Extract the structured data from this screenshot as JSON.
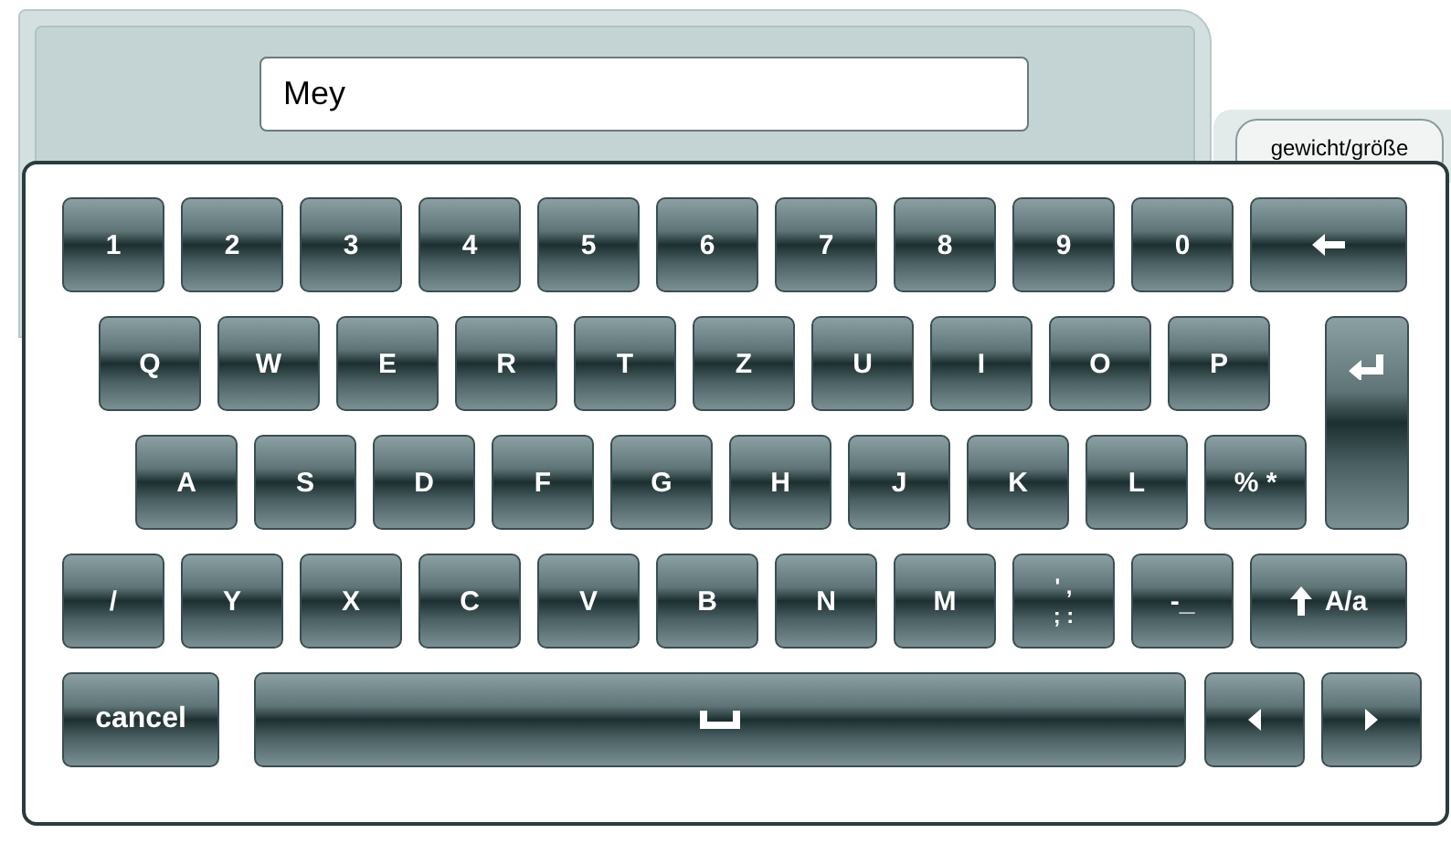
{
  "input": {
    "value": "Mey"
  },
  "tab": {
    "label": "gewicht/größe"
  },
  "keyboard": {
    "rows": [
      [
        {
          "kind": "char",
          "label": "1"
        },
        {
          "kind": "char",
          "label": "2"
        },
        {
          "kind": "char",
          "label": "3"
        },
        {
          "kind": "char",
          "label": "4"
        },
        {
          "kind": "char",
          "label": "5"
        },
        {
          "kind": "char",
          "label": "6"
        },
        {
          "kind": "char",
          "label": "7"
        },
        {
          "kind": "char",
          "label": "8"
        },
        {
          "kind": "char",
          "label": "9"
        },
        {
          "kind": "char",
          "label": "0"
        },
        {
          "kind": "backspace"
        }
      ],
      [
        {
          "kind": "char",
          "label": "Q"
        },
        {
          "kind": "char",
          "label": "W"
        },
        {
          "kind": "char",
          "label": "E"
        },
        {
          "kind": "char",
          "label": "R"
        },
        {
          "kind": "char",
          "label": "T"
        },
        {
          "kind": "char",
          "label": "Z"
        },
        {
          "kind": "char",
          "label": "U"
        },
        {
          "kind": "char",
          "label": "I"
        },
        {
          "kind": "char",
          "label": "O"
        },
        {
          "kind": "char",
          "label": "P"
        },
        {
          "kind": "enter"
        }
      ],
      [
        {
          "kind": "char",
          "label": "A"
        },
        {
          "kind": "char",
          "label": "S"
        },
        {
          "kind": "char",
          "label": "D"
        },
        {
          "kind": "char",
          "label": "F"
        },
        {
          "kind": "char",
          "label": "G"
        },
        {
          "kind": "char",
          "label": "H"
        },
        {
          "kind": "char",
          "label": "J"
        },
        {
          "kind": "char",
          "label": "K"
        },
        {
          "kind": "char",
          "label": "L"
        },
        {
          "kind": "char",
          "label": "% *"
        }
      ],
      [
        {
          "kind": "char",
          "label": "/"
        },
        {
          "kind": "char",
          "label": "Y"
        },
        {
          "kind": "char",
          "label": "X"
        },
        {
          "kind": "char",
          "label": "C"
        },
        {
          "kind": "char",
          "label": "V"
        },
        {
          "kind": "char",
          "label": "B"
        },
        {
          "kind": "char",
          "label": "N"
        },
        {
          "kind": "char",
          "label": "M"
        },
        {
          "kind": "char2",
          "label": "' ,",
          "label2": "; :"
        },
        {
          "kind": "char",
          "label": "-_"
        },
        {
          "kind": "shift",
          "label": "A/a"
        }
      ],
      [
        {
          "kind": "cancel",
          "label": "cancel"
        },
        {
          "kind": "space"
        },
        {
          "kind": "left"
        },
        {
          "kind": "right"
        }
      ]
    ]
  }
}
